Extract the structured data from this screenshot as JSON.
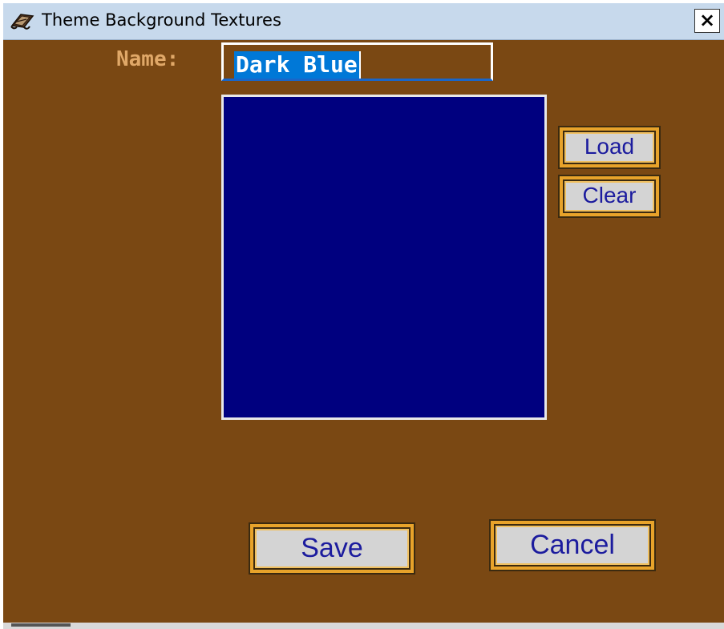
{
  "window": {
    "title": "Theme Background Textures",
    "close_label": "×"
  },
  "form": {
    "name_label": "Name:",
    "name_value": "Dark Blue"
  },
  "preview": {
    "color": "#00007F"
  },
  "buttons": {
    "load": "Load",
    "clear": "Clear",
    "save": "Save",
    "cancel": "Cancel"
  },
  "icons": {
    "app_icon": "scroll-icon",
    "close_icon": "close-icon"
  }
}
